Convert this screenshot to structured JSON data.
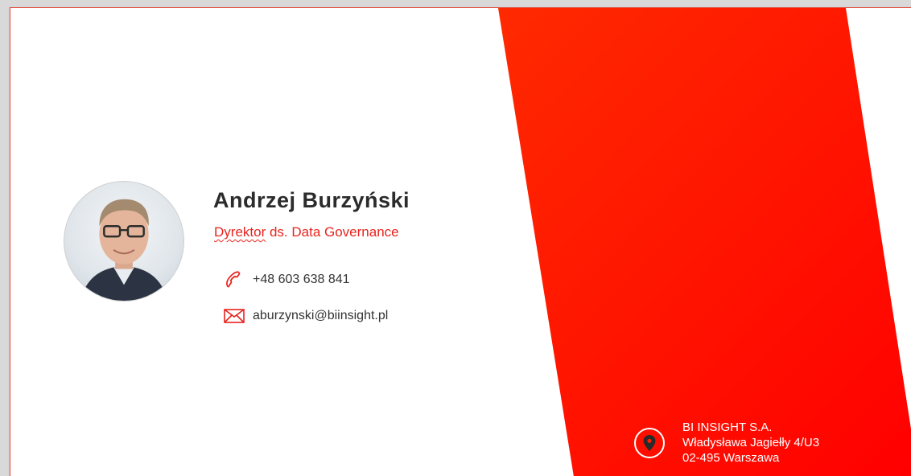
{
  "card": {
    "name": "Andrzej Burzyński",
    "role_underlined": "Dyrektor",
    "role_rest": " ds. Data Governance",
    "phone": "+48 603 638 841",
    "email": "aburzynski@biinsight.pl"
  },
  "company": {
    "name": "BI INSIGHT S.A.",
    "street": "Władysława Jagiełły 4/U3",
    "city": "02-495 Warszawa"
  },
  "colors": {
    "accent": "#e8231e",
    "band_start": "#ff5a00",
    "band_end": "#ff0000",
    "text_dark": "#2b2b2b"
  },
  "icons": {
    "phone": "phone-icon",
    "email": "envelope-icon",
    "location": "map-pin-icon"
  }
}
